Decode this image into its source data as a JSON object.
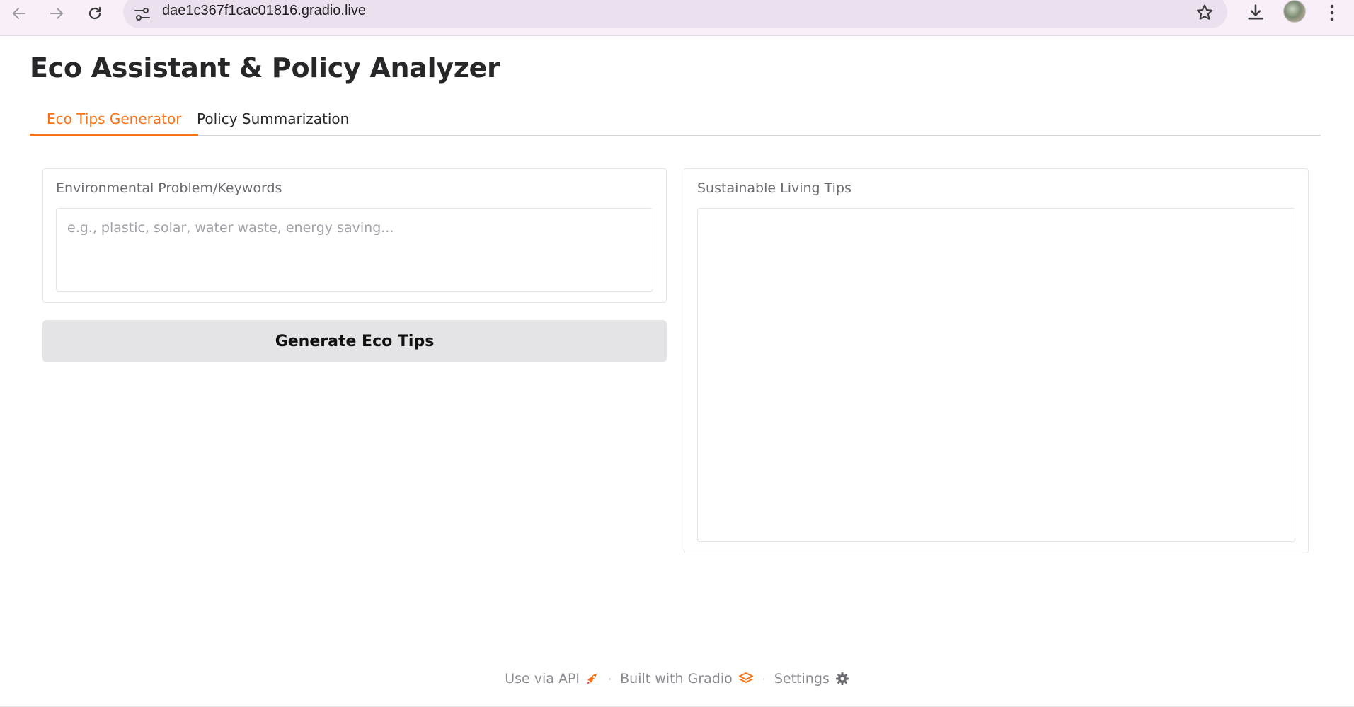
{
  "browser": {
    "url": "dae1c367f1cac01816.gradio.live",
    "icons": [
      "back-icon",
      "forward-icon",
      "reload-icon",
      "site-info-icon",
      "bookmark-star-icon",
      "download-icon",
      "profile-avatar",
      "menu-icon"
    ]
  },
  "app": {
    "title": "Eco Assistant & Policy Analyzer",
    "tabs": [
      {
        "label": "Eco Tips Generator",
        "active": true
      },
      {
        "label": "Policy Summarization",
        "active": false
      }
    ],
    "input": {
      "label": "Environmental Problem/Keywords",
      "placeholder": "e.g., plastic, solar, water waste, energy saving...",
      "value": ""
    },
    "generate_button": "Generate Eco Tips",
    "output": {
      "label": "Sustainable Living Tips",
      "value": ""
    }
  },
  "footer": {
    "api_label": "Use via API",
    "built_label": "Built with Gradio",
    "settings_label": "Settings",
    "separator": "·"
  },
  "colors": {
    "accent": "#f97316",
    "button_bg": "#e4e4e7",
    "chrome_bg": "#f8eff8"
  }
}
